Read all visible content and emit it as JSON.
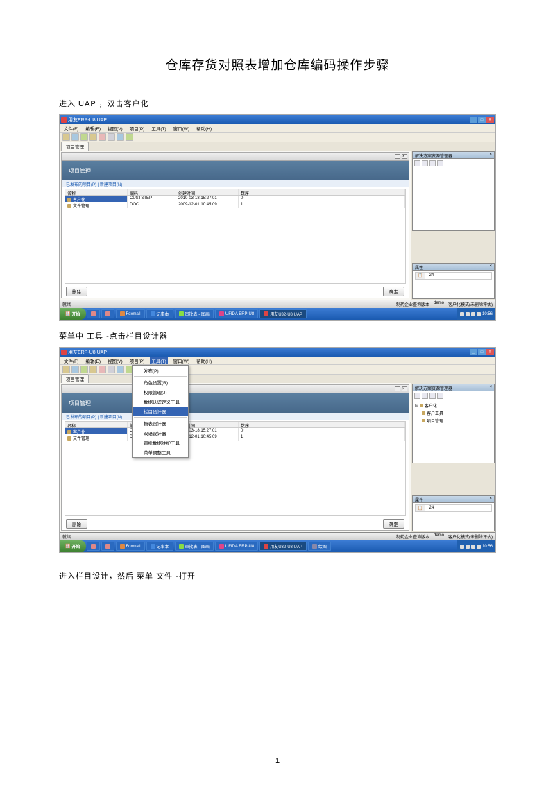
{
  "doc": {
    "title": "仓库存货对照表增加仓库编码操作步骤",
    "step1": "进入 UAP ，双击客户化",
    "step2": "菜单中   工具 -点击栏目设计器",
    "step3": "进入栏目设计，然后     菜单   文件 -打开",
    "page_number": "1"
  },
  "app": {
    "title": "用友ERP-U8 UAP",
    "menu": [
      "文件(F)",
      "编辑(E)",
      "视图(V)",
      "项目(P)",
      "工具(T)",
      "窗口(W)",
      "帮助(H)"
    ],
    "tab": "项目管理",
    "banner": "项目管理",
    "links": "已发布的项目(P) | 新建项目(N)",
    "table": {
      "headers": [
        "名称",
        "编码",
        "创建时间",
        "数序"
      ],
      "rows": [
        {
          "name": "客户化",
          "code": "CUSTSTEP",
          "time": "2010-03-18 15:27:01",
          "num": "0",
          "selected": true
        },
        {
          "name": "文件管理",
          "code": "DOC",
          "time": "2009-12-01 10:45:09",
          "num": "1",
          "selected": false
        }
      ]
    },
    "buttons": {
      "delete": "删除",
      "ok": "确定"
    },
    "status": {
      "left": "就绪",
      "mid": "制药企业查询版本",
      "user": "demo",
      "right": "客户化模式(未删除评估)"
    },
    "sidebar": {
      "title1": "解决方案资源管理器",
      "title2": "属性",
      "tree": [
        "客户化",
        "客户工具",
        "项目管理"
      ],
      "prop_col": "24"
    }
  },
  "taskbar": {
    "start": "开始",
    "items": [
      "",
      "",
      "Foxmail",
      "记事本",
      "审批表 - 图画",
      "UFIDA ERP-U8",
      "用友U32-U8 UAP",
      "绘图"
    ],
    "time": "10:56"
  },
  "dropdown": {
    "items": [
      "发布(P)",
      "角色设置(R)",
      "权限管理(J)",
      "数据认识定义工具",
      "栏目设计器",
      "报表设计器",
      "双语设计器",
      "审批数据维护工具",
      "菜单调整工具"
    ],
    "highlighted_index": 4
  }
}
